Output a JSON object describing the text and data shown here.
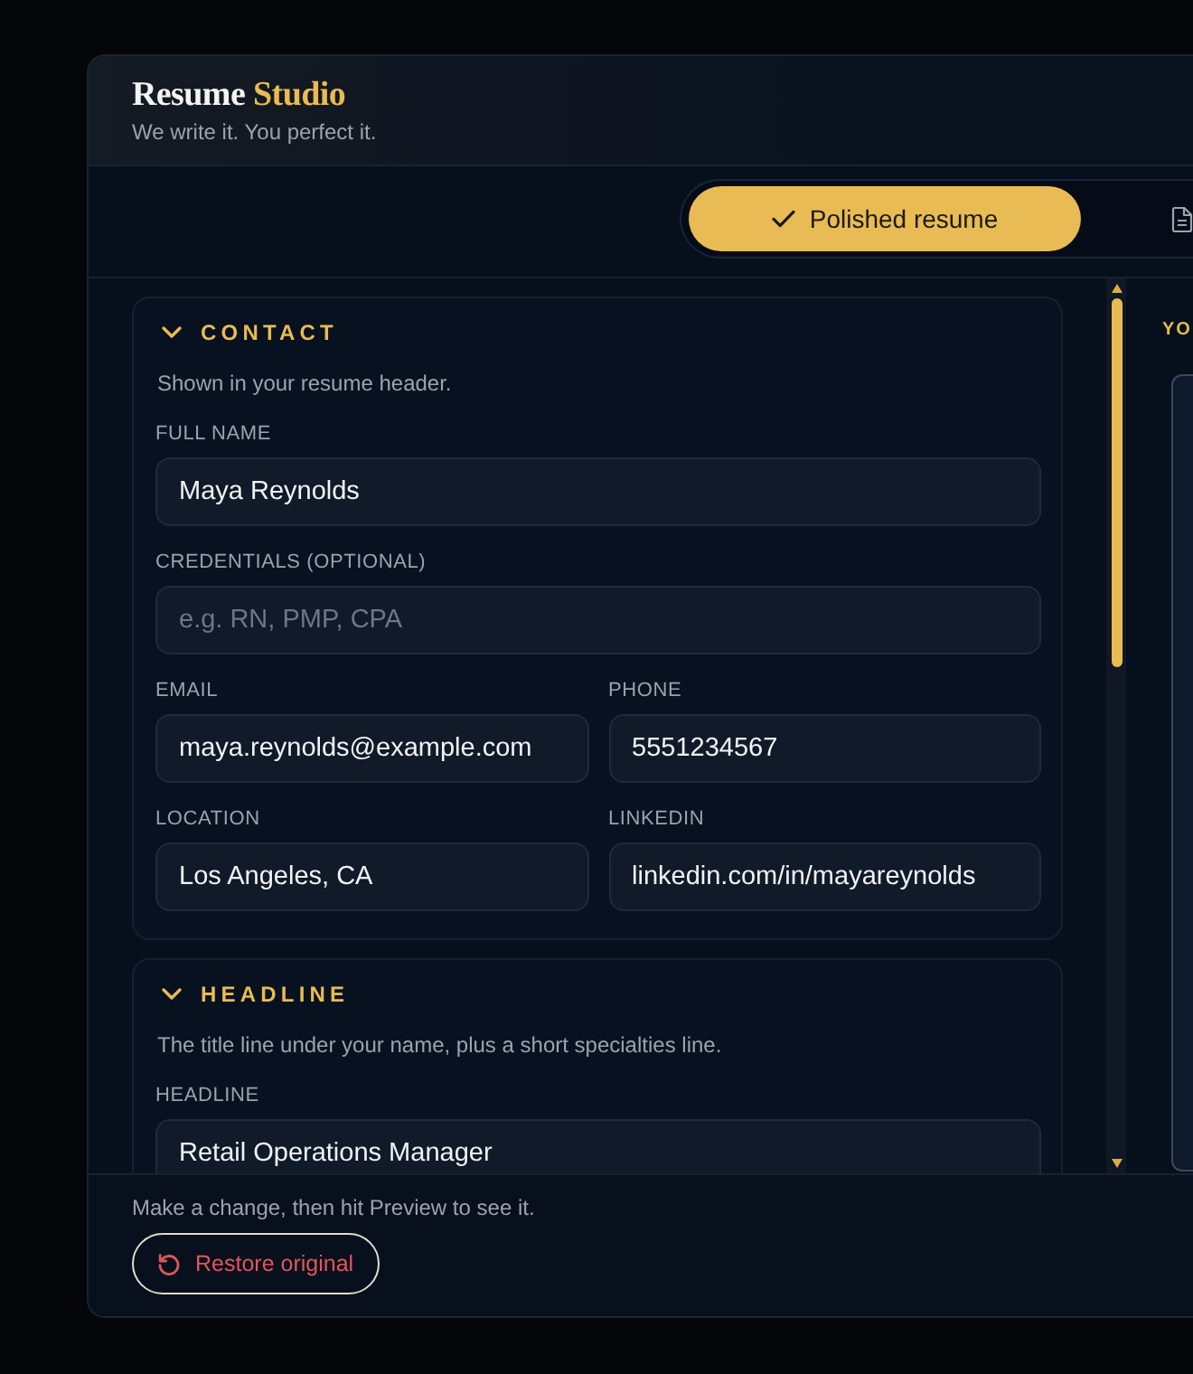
{
  "brand": {
    "name": "Resume",
    "accent": "Studio",
    "tagline": "We write it. You perfect it."
  },
  "view_tabs": [
    {
      "label": "Polished resume",
      "selected": true
    },
    {
      "selected": false
    }
  ],
  "sections": [
    {
      "title": "CONTACT",
      "expanded": true,
      "description": "Shown in your resume header.",
      "rows": [
        {
          "fields": [
            {
              "label": "FULL NAME",
              "value": "Maya Reynolds"
            }
          ]
        },
        {
          "fields": [
            {
              "label": "CREDENTIALS (OPTIONAL)",
              "placeholder": "e.g. RN, PMP, CPA"
            }
          ]
        },
        {
          "fields": [
            {
              "label": "EMAIL",
              "value": "maya.reynolds@example.com"
            },
            {
              "label": "PHONE",
              "value": "5551234567"
            }
          ]
        },
        {
          "fields": [
            {
              "label": "LOCATION",
              "value": "Los Angeles, CA"
            },
            {
              "label": "LINKEDIN",
              "value": "linkedin.com/in/mayareynolds"
            }
          ]
        }
      ]
    },
    {
      "title": "HEADLINE",
      "expanded": true,
      "description": "The title line under your name, plus a short specialties line.",
      "rows": [
        {
          "fields": [
            {
              "label": "HEADLINE",
              "value": "Retail Operations Manager"
            }
          ]
        }
      ]
    }
  ],
  "preview": {
    "label": "YO"
  },
  "footer": {
    "hint": "Make a change, then hit Preview to see it.",
    "restore_button": "Restore original"
  }
}
